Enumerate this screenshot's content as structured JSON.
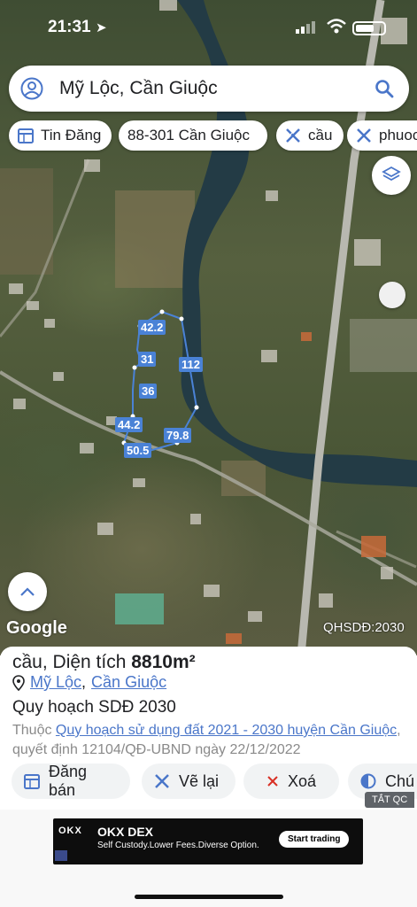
{
  "status_bar": {
    "time": "21:31"
  },
  "search": {
    "text": "Mỹ Lộc, Cần Giuộc"
  },
  "chips": [
    {
      "label": "Tin Đăng",
      "icon": "calendar-icon"
    },
    {
      "label": "88-301 Cần Giuộc",
      "icon": ""
    },
    {
      "label": "cầu",
      "icon": "ruler-cross-icon"
    },
    {
      "label": "phuoc",
      "icon": "ruler-cross-icon"
    }
  ],
  "map": {
    "parcel_labels": [
      "42.2",
      "31",
      "36",
      "112",
      "44.2",
      "79.8",
      "50.5"
    ],
    "google_label": "Google",
    "watermark": "QHSDĐ:2030"
  },
  "panel": {
    "title_prefix": "cầu, Diện tích ",
    "area": "8810m²",
    "location_1": "Mỹ Lộc",
    "location_sep": ",",
    "location_2": "Cần Giuộc",
    "subtitle": "Quy hoạch SDĐ 2030",
    "desc_prefix": "Thuộc ",
    "desc_link": "Quy hoạch sử dụng đất 2021 - 2030 huyện Cần Giuộc",
    "desc_suffix": ", quyết định 12104/QĐ-UBND ngày 22/12/2022",
    "actions": [
      {
        "label": "Đăng bán",
        "icon": "calendar-icon"
      },
      {
        "label": "Vẽ lại",
        "icon": "ruler-cross-icon"
      },
      {
        "label": "Xoá",
        "icon": "close-icon"
      },
      {
        "label": "Chú",
        "icon": "contrast-icon"
      }
    ]
  },
  "ad_badge": "TẮT QC",
  "ad": {
    "logo": "OKX",
    "headline": "OKX DEX",
    "subtext": "Self Custody.Lower Fees.Diverse Option.",
    "cta": "Start trading"
  },
  "colors": {
    "accent": "#4a76c9",
    "parcel": "#4a82d6"
  }
}
